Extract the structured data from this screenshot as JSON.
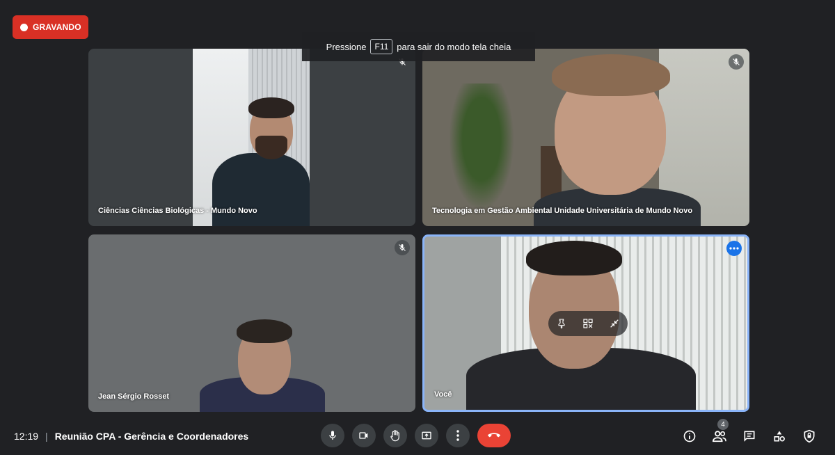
{
  "recording": {
    "label": "GRAVANDO",
    "color": "#d93025"
  },
  "fullscreen_hint": {
    "prefix": "Pressione",
    "key": "F11",
    "suffix": "para sair do modo tela cheia"
  },
  "tiles": [
    {
      "name": "Ciências Ciências Biológicas - Mundo Novo",
      "muted": true
    },
    {
      "name": "Tecnologia em Gestão Ambiental Unidade Universitária de Mundo Novo",
      "muted": true
    },
    {
      "name": "Jean Sérgio Rosset",
      "muted": true
    },
    {
      "name": "Você",
      "active": true,
      "highlight_color": "#8ab4f8"
    }
  ],
  "self_tile_controls": [
    "pin-icon",
    "unpin-grid-icon",
    "minimize-icon"
  ],
  "meeting": {
    "time": "12:19",
    "separator": "|",
    "title": "Reunião CPA - Gerência e Coordenadores"
  },
  "controls": [
    "mic-icon",
    "camera-icon",
    "raise-hand-icon",
    "present-screen-icon",
    "more-options-icon",
    "end-call-icon"
  ],
  "end_call_color": "#ea4335",
  "side_panel": {
    "participants_count": "4",
    "icons": [
      "info-icon",
      "people-icon",
      "chat-icon",
      "activities-icon",
      "host-controls-icon"
    ]
  }
}
